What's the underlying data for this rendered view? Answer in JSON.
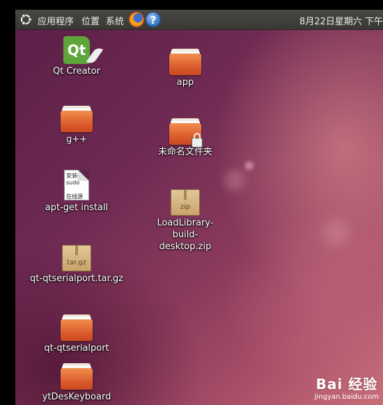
{
  "panel": {
    "menus": [
      "应用程序",
      "位置",
      "系统"
    ],
    "clock": "8月22日星期六 下午"
  },
  "desktop": {
    "icons": [
      {
        "label": "Qt Creator",
        "icon": "qt-creator-icon"
      },
      {
        "label": "app",
        "icon": "folder-icon"
      },
      {
        "label": "g++",
        "icon": "folder-icon"
      },
      {
        "label": "未命名文件夹",
        "icon": "locked-folder-icon"
      },
      {
        "label": "apt-get install",
        "icon": "text-file-icon",
        "preview": [
          "安装g+",
          "sudo",
          "",
          "在线源"
        ]
      },
      {
        "label": "LoadLibrary-build-desktop.zip",
        "icon": "zip-archive-icon",
        "badge": "zip"
      },
      {
        "label": "qt-qtserialport.tar.gz",
        "icon": "tar-archive-icon",
        "badge": "tar.gz"
      },
      {
        "label": "qt-qtserialport",
        "icon": "folder-icon"
      },
      {
        "label": "ytDesKeyboard",
        "icon": "folder-icon"
      }
    ]
  },
  "watermark": {
    "brand": "Bai 经验",
    "url": "jingyan.baidu.com"
  },
  "colors": {
    "panel": "#3f3d39",
    "folder": "#e56f35",
    "wallpaper": "#6e2a52"
  }
}
